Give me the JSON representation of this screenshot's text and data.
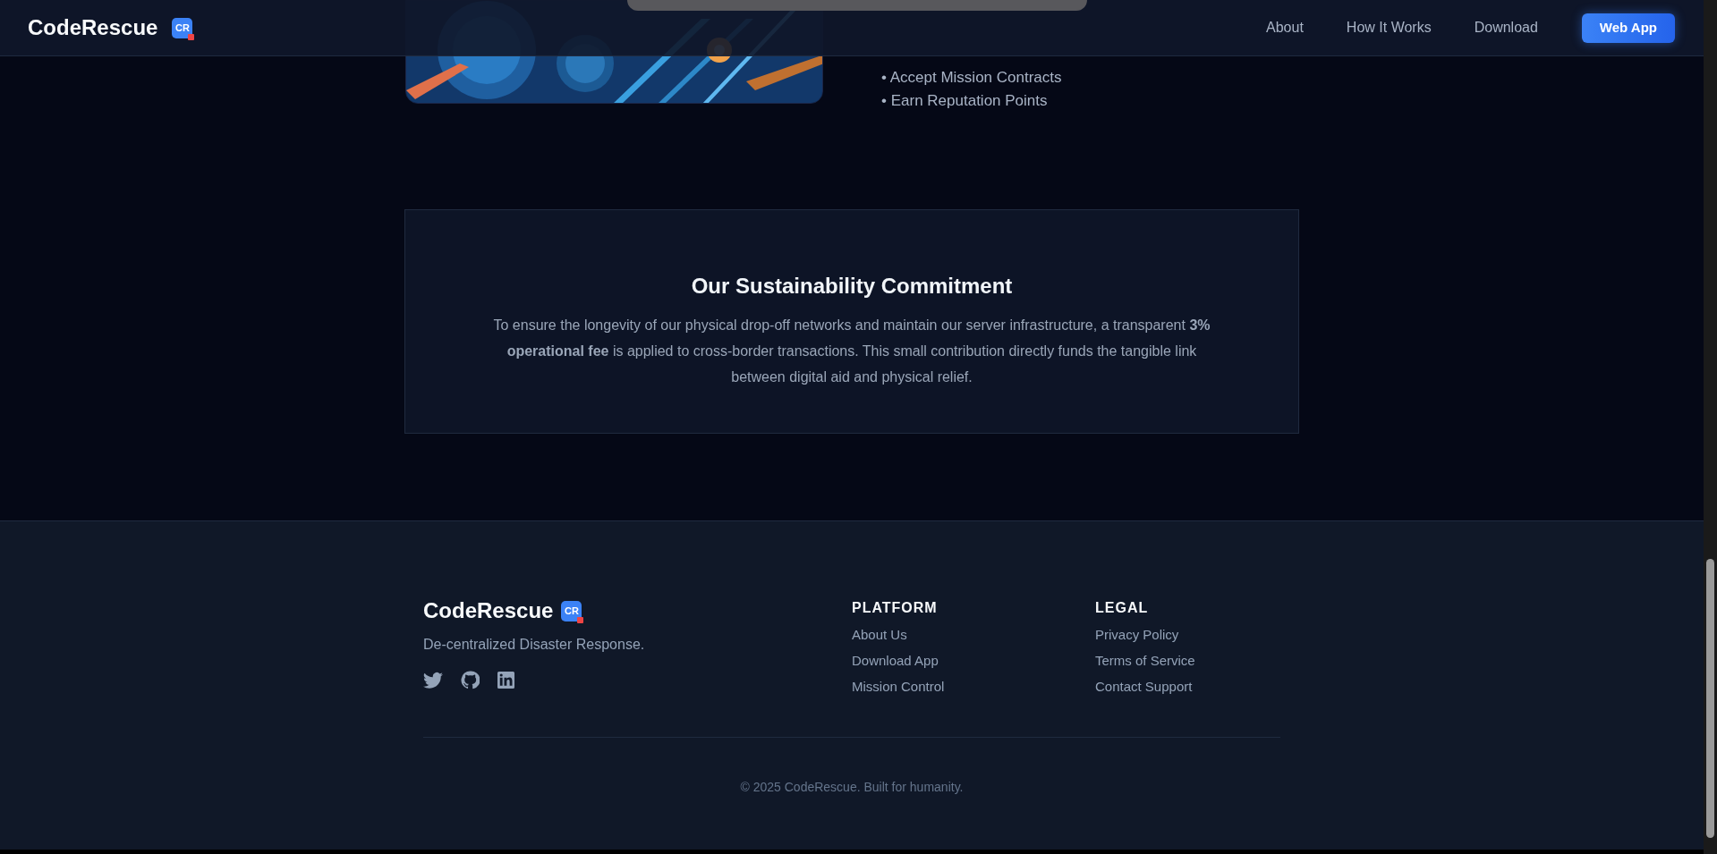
{
  "header": {
    "logo": "CodeRescue",
    "logo_badge": "CR",
    "nav": [
      {
        "label": "About"
      },
      {
        "label": "How It Works"
      },
      {
        "label": "Download"
      }
    ],
    "cta": "Web App"
  },
  "hero": {
    "picture": {
      "kind": "picture"
    },
    "bullets": [
      "• Accept Mission Contracts",
      "• Earn Reputation Points"
    ]
  },
  "commitment": {
    "title": "Our Sustainability Commitment",
    "body": "To ensure the longevity of our physical drop-off networks and maintain our server infrastructure, a transparent **3% operational fee** is applied to cross-border transactions. This small contribution directly funds the tangible link between digital aid and physical relief."
  },
  "footer": {
    "logo": "CodeRescue",
    "logo_badge": "CR",
    "tagline": "De-centralized Disaster Response.",
    "columns": [
      {
        "heading": "PLATFORM",
        "links": [
          "About Us",
          "Download App",
          "Mission Control"
        ]
      },
      {
        "heading": "LEGAL",
        "links": [
          "Privacy Policy",
          "Terms of Service",
          "Contact Support"
        ]
      }
    ],
    "copyright": "© 2025 CodeRescue. Built for humanity."
  }
}
